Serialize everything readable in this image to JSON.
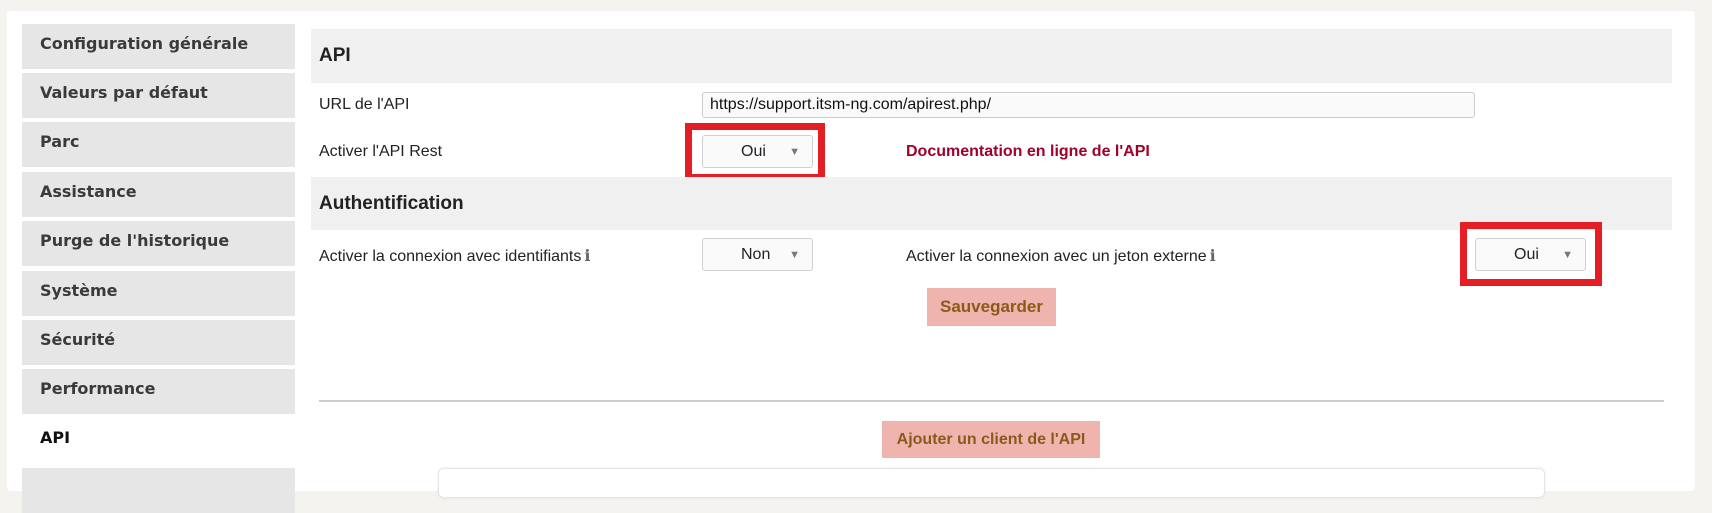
{
  "sidebar": {
    "items": [
      {
        "label": "Configuration générale"
      },
      {
        "label": "Valeurs par défaut"
      },
      {
        "label": "Parc"
      },
      {
        "label": "Assistance"
      },
      {
        "label": "Purge de l'historique"
      },
      {
        "label": "Système"
      },
      {
        "label": "Sécurité"
      },
      {
        "label": "Performance"
      },
      {
        "label": "API",
        "active": true
      },
      {
        "label": ""
      }
    ]
  },
  "api": {
    "title": "API",
    "url_label": "URL de l'API",
    "url_value": "https://support.itsm-ng.com/apirest.php/",
    "enable_rest_label": "Activer l'API Rest",
    "enable_rest_value": "Oui",
    "doc_link": "Documentation en ligne de l'API"
  },
  "auth": {
    "title": "Authentification",
    "credentials_label": "Activer la connexion avec identifiants",
    "credentials_value": "Non",
    "token_label": "Activer la connexion avec un jeton externe",
    "token_value": "Oui",
    "info_icon": "i"
  },
  "actions": {
    "save": "Sauvegarder",
    "add_client": "Ajouter un client de l'API"
  },
  "colors": {
    "highlight": "#e31e24",
    "link": "#a0002a",
    "button_bg": "#f0b4ae",
    "button_text": "#8b5a1a"
  }
}
